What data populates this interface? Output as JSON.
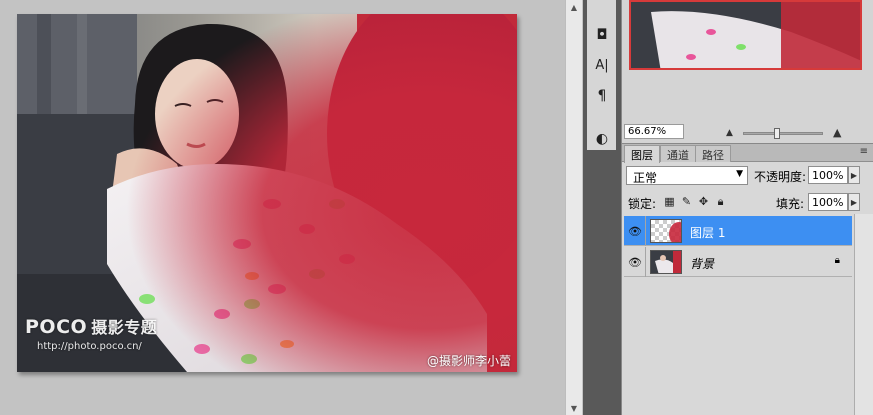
{
  "canvas": {
    "watermark_brand": "POCO",
    "watermark_brand_sub": "摄影专题",
    "watermark_url": "http://photo.poco.cn/",
    "credit": "@摄影师李小蕾"
  },
  "navigator": {
    "zoom_value": "66.67%",
    "zoom_slider_fraction": 0.42
  },
  "layers_panel": {
    "tabs": [
      {
        "label": "图层",
        "active": true
      },
      {
        "label": "通道",
        "active": false
      },
      {
        "label": "路径",
        "active": false
      }
    ],
    "menu_icon": "≡",
    "blend_mode": "正常",
    "opacity_label": "不透明度:",
    "opacity_value": "100%",
    "lock_label": "锁定:",
    "fill_label": "填充:",
    "fill_value": "100%",
    "layers": [
      {
        "name": "图层 1",
        "selected": true,
        "thumb": "transparent-red",
        "locked": false
      },
      {
        "name": "背景",
        "selected": false,
        "thumb": "photo",
        "locked": true
      }
    ]
  },
  "tools": [
    {
      "icon": "quick-mask-icon",
      "glyph": "◘"
    },
    {
      "icon": "type-tool-icon",
      "glyph": "A|"
    },
    {
      "icon": "paragraph-icon",
      "glyph": "¶"
    },
    {
      "icon": "dodge-tool-icon",
      "glyph": "◐"
    }
  ],
  "colors": {
    "accent_selection": "#3d8ff2",
    "red_overlay": "#c8283c",
    "nav_frame": "#d63a3a"
  }
}
